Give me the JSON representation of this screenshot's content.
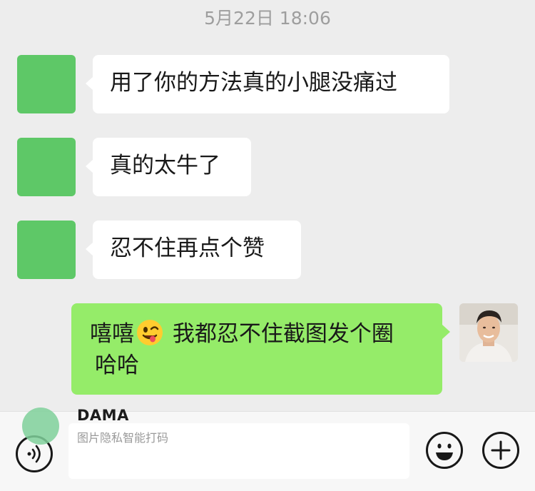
{
  "chat": {
    "timestamp": "5月22日 18:06",
    "messages": [
      {
        "side": "left",
        "text": "用了你的方法真的小腿没痛过"
      },
      {
        "side": "left",
        "text": "真的太牛了"
      },
      {
        "side": "left",
        "text": "忍不住再点个赞"
      },
      {
        "side": "right",
        "line1_before_emoji": "嘻嘻",
        "emoji": "winking-face-with-tongue",
        "line1_after_emoji": " 我都忍不住截图发个圈",
        "line2": "哈哈"
      }
    ]
  },
  "watermark": {
    "name": "DAMA",
    "caption": "图片隐私智能打码"
  },
  "input_bar": {
    "voice_icon": "voice-icon",
    "emoji_icon": "smiley-icon",
    "more_icon": "plus-icon"
  },
  "colors": {
    "background": "#ededed",
    "incoming_bubble": "#ffffff",
    "outgoing_bubble": "#95ec69",
    "redacted_avatar": "#5ec867"
  }
}
